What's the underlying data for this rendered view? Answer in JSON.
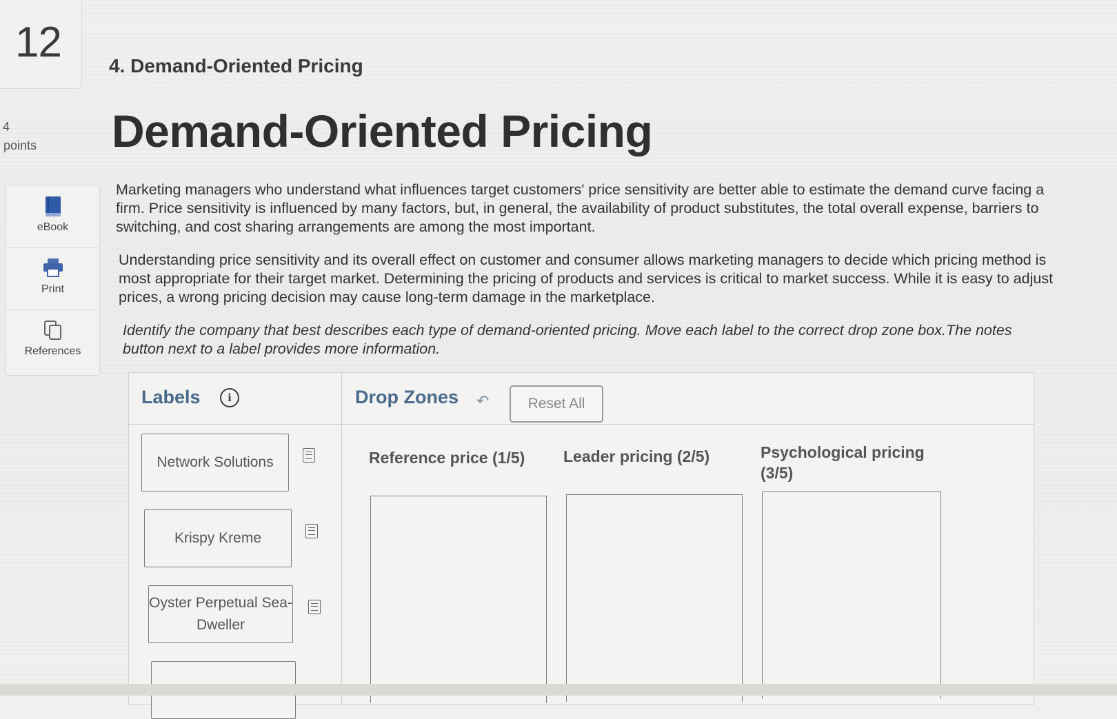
{
  "question": {
    "number": "12",
    "points_value": "4",
    "points_label": "points"
  },
  "tools": [
    {
      "label": "eBook",
      "icon": "book-icon"
    },
    {
      "label": "Print",
      "icon": "printer-icon"
    },
    {
      "label": "References",
      "icon": "copy-icon"
    }
  ],
  "section_title": "4. Demand-Oriented Pricing",
  "main_title": "Demand-Oriented Pricing",
  "paragraphs": {
    "p1": "Marketing managers who understand what influences target customers' price sensitivity are better able to estimate the demand curve facing a firm. Price sensitivity is influenced by many factors, but, in general, the availability of product substitutes, the total overall expense, barriers to switching, and cost sharing arrangements are among the most important.",
    "p2": "Understanding price sensitivity and its overall effect on customer and consumer allows marketing managers to decide which pricing method is most appropriate for their target market. Determining the pricing of products and services is critical to market success. While it is easy to adjust prices, a wrong pricing decision may cause long-term damage in the marketplace.",
    "instructions": "Identify the company that best describes each type of demand-oriented pricing. Move each label to the correct drop zone box.The notes button next to a label provides more information."
  },
  "widget": {
    "labels_title": "Labels",
    "info_glyph": "i",
    "drop_zones_title": "Drop Zones",
    "undo_glyph": "↶",
    "reset_label": "Reset All",
    "labels": [
      "Network Solutions",
      "Krispy Kreme",
      "Oyster Perpetual Sea-Dweller"
    ],
    "zones": [
      "Reference price (1/5)",
      "Leader pricing (2/5)",
      "Psychological pricing (3/5)"
    ]
  },
  "colors": {
    "widget_heading": "#4a6a8c",
    "ebook_icon": "#3a5f9e",
    "print_icon": "#4a6fb0"
  }
}
